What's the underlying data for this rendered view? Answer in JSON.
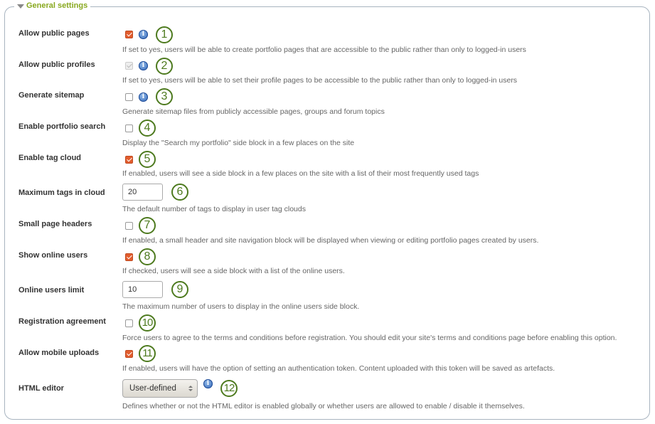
{
  "section": {
    "title": "General settings",
    "collapse_icon": "triangle-down-icon"
  },
  "settings": [
    {
      "label": "Allow public pages",
      "type": "checkbox",
      "checked": true,
      "disabled": false,
      "info": true,
      "marker": "1",
      "description": "If set to yes, users will be able to create portfolio pages that are accessible to the public rather than only to logged-in users"
    },
    {
      "label": "Allow public profiles",
      "type": "checkbox",
      "checked": true,
      "disabled": true,
      "info": true,
      "marker": "2",
      "description": "If set to yes, users will be able to set their profile pages to be accessible to the public rather than only to logged-in users"
    },
    {
      "label": "Generate sitemap",
      "type": "checkbox",
      "checked": false,
      "disabled": false,
      "info": true,
      "marker": "3",
      "description": "Generate sitemap files from publicly accessible pages, groups and forum topics"
    },
    {
      "label": "Enable portfolio search",
      "type": "checkbox",
      "checked": false,
      "disabled": false,
      "info": false,
      "marker": "4",
      "description": "Display the \"Search my portfolio\" side block in a few places on the site"
    },
    {
      "label": "Enable tag cloud",
      "type": "checkbox",
      "checked": true,
      "disabled": false,
      "info": false,
      "marker": "5",
      "description": "If enabled, users will see a side block in a few places on the site with a list of their most frequently used tags"
    },
    {
      "label": "Maximum tags in cloud",
      "type": "text",
      "value": "20",
      "info": false,
      "marker": "6",
      "description": "The default number of tags to display in user tag clouds"
    },
    {
      "label": "Small page headers",
      "type": "checkbox",
      "checked": false,
      "disabled": false,
      "info": false,
      "marker": "7",
      "description": "If enabled, a small header and site navigation block will be displayed when viewing or editing portfolio pages created by users."
    },
    {
      "label": "Show online users",
      "type": "checkbox",
      "checked": true,
      "disabled": false,
      "info": false,
      "marker": "8",
      "description": "If checked, users will see a side block with a list of the online users."
    },
    {
      "label": "Online users limit",
      "type": "text",
      "value": "10",
      "info": false,
      "marker": "9",
      "description": "The maximum number of users to display in the online users side block."
    },
    {
      "label": "Registration agreement",
      "type": "checkbox",
      "checked": false,
      "disabled": false,
      "info": false,
      "marker": "10",
      "description": "Force users to agree to the terms and conditions before registration. You should edit your site's terms and conditions page before enabling this option."
    },
    {
      "label": "Allow mobile uploads",
      "type": "checkbox",
      "checked": true,
      "disabled": false,
      "info": false,
      "marker": "11",
      "description": "If enabled, users will have the option of setting an authentication token. Content uploaded with this token will be saved as artefacts."
    },
    {
      "label": "HTML editor",
      "type": "select",
      "value": "User-defined",
      "info": true,
      "marker": "12",
      "description": "Defines whether or not the HTML editor is enabled globally or whether users are allowed to enable / disable it themselves."
    }
  ],
  "colors": {
    "legend": "#88a81e",
    "checked": "#e25d2e",
    "marker": "#4d7a1e",
    "info": "#2f63b5"
  },
  "icons": {
    "info": "info-icon",
    "info_glyph": "i"
  }
}
